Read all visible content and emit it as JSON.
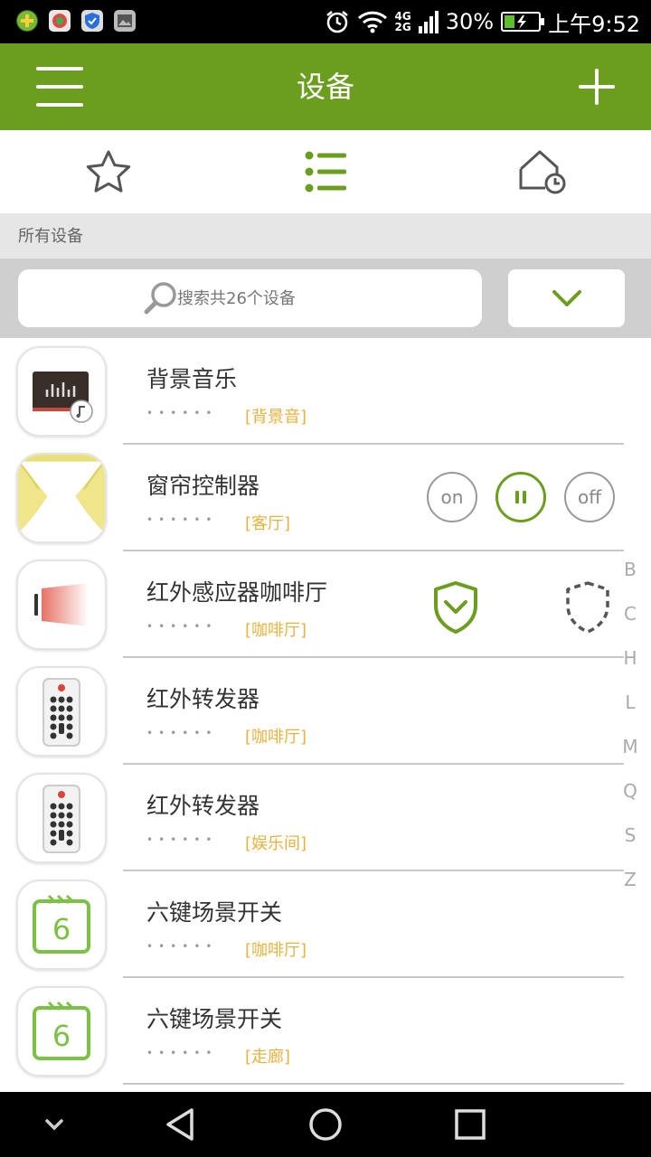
{
  "status_bar": {
    "network": [
      "4G",
      "2G"
    ],
    "battery_percent": "30%",
    "battery_level": 0.3,
    "time": "上午9:52"
  },
  "header": {
    "title": "设备",
    "menu_icon": "hamburger-menu-icon",
    "add_icon": "plus-icon",
    "accent_color": "#6b9e1f"
  },
  "tabs": [
    {
      "icon": "star-icon",
      "active": false
    },
    {
      "icon": "list-icon",
      "active": true
    },
    {
      "icon": "home-clock-icon",
      "active": false
    }
  ],
  "section_label": "所有设备",
  "search": {
    "placeholder": "搜索共26个设备"
  },
  "devices": [
    {
      "name": "背景音乐",
      "dots": "••••••",
      "room": "[背景音]",
      "icon": "music-player-icon"
    },
    {
      "name": "窗帘控制器",
      "dots": "••••••",
      "room": "[客厅]",
      "icon": "curtain-icon",
      "controls": {
        "on": "on",
        "off": "off",
        "pause": "pause-icon"
      }
    },
    {
      "name": "红外感应器咖啡厅",
      "dots": "••••••",
      "room": "[咖啡厅]",
      "icon": "infrared-sensor-icon",
      "controls": {
        "arm": "shield-check-icon",
        "disarm": "shield-dashed-icon"
      }
    },
    {
      "name": "红外转发器",
      "dots": "••••••",
      "room": "[咖啡厅]",
      "icon": "remote-control-icon"
    },
    {
      "name": "红外转发器",
      "dots": "••••••",
      "room": "[娱乐间]",
      "icon": "remote-control-icon"
    },
    {
      "name": "六键场景开关",
      "dots": "••••••",
      "room": "[咖啡厅]",
      "icon": "scene-switch-icon",
      "icon_number": "6"
    },
    {
      "name": "六键场景开关",
      "dots": "••••••",
      "room": "[走廊]",
      "icon": "scene-switch-icon",
      "icon_number": "6"
    }
  ],
  "alpha_index": [
    "B",
    "C",
    "H",
    "L",
    "M",
    "Q",
    "S",
    "Z"
  ],
  "colors": {
    "room_label": "#e9b23e",
    "divider": "#c8c8c8",
    "section_bg": "#e6e6e6",
    "search_bg": "#cfcfcf"
  }
}
